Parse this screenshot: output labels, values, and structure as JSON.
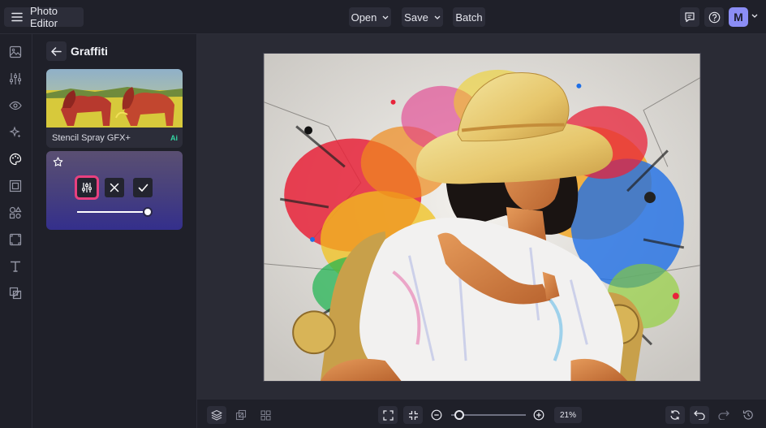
{
  "header": {
    "app_title": "Photo Editor",
    "open_label": "Open",
    "save_label": "Save",
    "batch_label": "Batch",
    "avatar_initial": "M"
  },
  "left_rail": {
    "items": [
      {
        "icon": "image-icon"
      },
      {
        "icon": "sliders-icon"
      },
      {
        "icon": "eye-icon"
      },
      {
        "icon": "sparkle-icon"
      },
      {
        "icon": "palette-icon"
      },
      {
        "icon": "frame-icon"
      },
      {
        "icon": "shapes-icon"
      },
      {
        "icon": "texture-icon"
      },
      {
        "icon": "text-icon"
      },
      {
        "icon": "overlay-icon"
      }
    ]
  },
  "panel": {
    "title": "Graffiti",
    "effect": {
      "name": "Stencil Spray GFX+",
      "badge": "Ai"
    },
    "intensity": 1.0
  },
  "bottom": {
    "zoom_label": "21%",
    "zoom_value": 0.21
  },
  "colors": {
    "accent_highlight": "#e8407f",
    "avatar": "#8b8df5",
    "ai_badge": "#33d6a3"
  }
}
